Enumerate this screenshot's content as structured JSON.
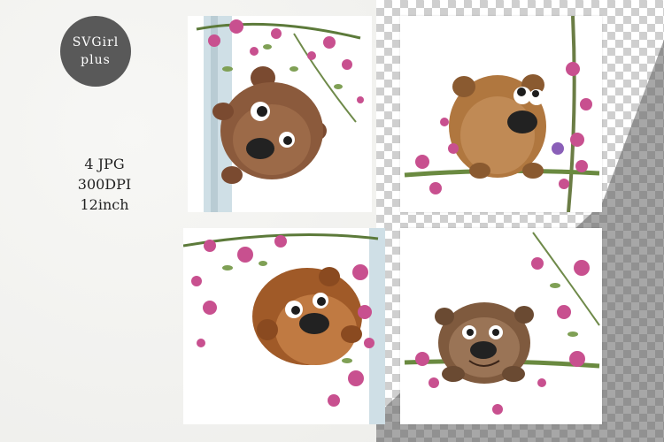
{
  "brand": {
    "line1": "SVGirl",
    "line2": "plus"
  },
  "specs": [
    "4 JPG",
    "300DPI",
    "12inch"
  ],
  "colors": {
    "logo_bg": "#595959",
    "flower": "#c8508f",
    "bear_brown": "#8b5a3c",
    "bear_orange": "#b86a32"
  }
}
